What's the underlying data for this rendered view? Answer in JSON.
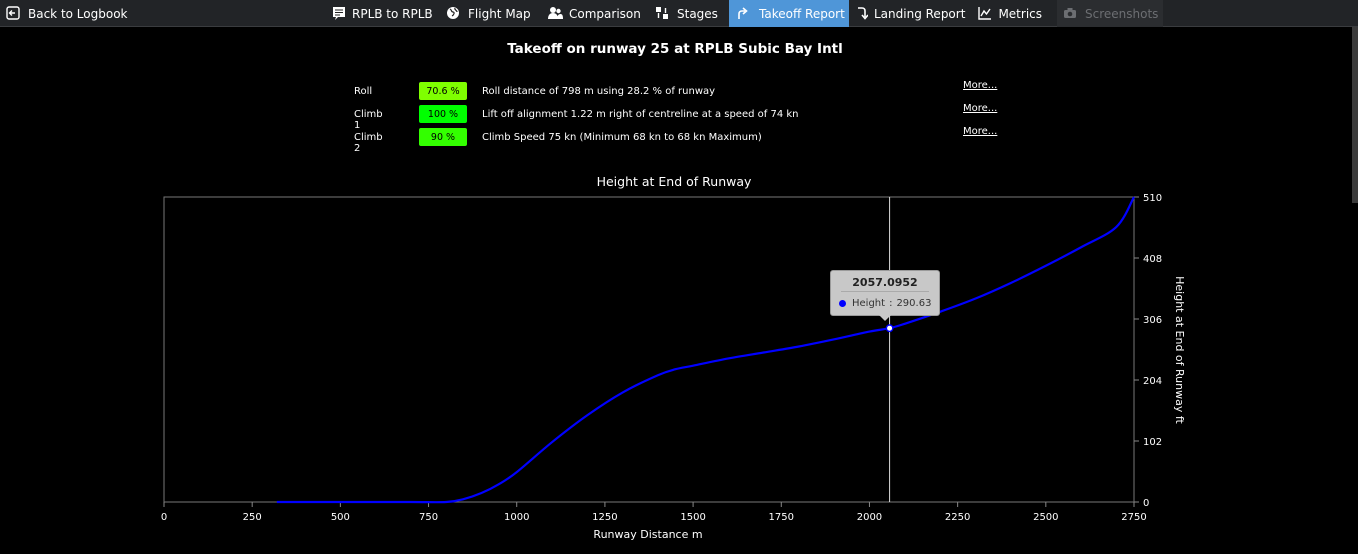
{
  "nav": {
    "back": {
      "label": "Back to Logbook",
      "icon": "back-arrow-icon"
    },
    "items": [
      {
        "label": "RPLB to RPLB",
        "icon": "document-icon",
        "state": "normal"
      },
      {
        "label": "Flight Map",
        "icon": "globe-icon",
        "state": "normal"
      },
      {
        "label": "Comparison",
        "icon": "users-icon",
        "state": "normal"
      },
      {
        "label": "Stages",
        "icon": "stages-icon",
        "state": "normal"
      },
      {
        "label": "Takeoff Report",
        "icon": "takeoff-arrow-icon",
        "state": "active"
      },
      {
        "label": "Landing Report",
        "icon": "landing-arrow-icon",
        "state": "normal"
      },
      {
        "label": "Metrics",
        "icon": "line-chart-icon",
        "state": "normal"
      },
      {
        "label": "Screenshots",
        "icon": "camera-icon",
        "state": "disabled"
      }
    ]
  },
  "report": {
    "title": "Takeoff on runway 25 at RPLB Subic Bay Intl",
    "metrics": [
      {
        "label": "Roll",
        "score": "70.6 %",
        "color": "#7fff00",
        "description": "Roll distance of 798 m using 28.2 % of runway",
        "more": "More..."
      },
      {
        "label": "Climb 1",
        "score": "100 %",
        "color": "#00ff00",
        "description": "Lift off alignment 1.22 m right of centreline at a speed of 74 kn",
        "more": "More..."
      },
      {
        "label": "Climb 2",
        "score": "90 %",
        "color": "#33ff00",
        "description": "Climb Speed 75 kn (Minimum 68 kn to 68 kn Maximum)",
        "more": "More..."
      }
    ]
  },
  "chart_data": {
    "type": "line",
    "title": "Height at End of Runway",
    "xlabel": "Runway Distance m",
    "ylabel": "Height at End of Runway ft",
    "xlim": [
      0,
      2750
    ],
    "ylim": [
      0,
      510
    ],
    "x_ticks": [
      "0",
      "250",
      "500",
      "750",
      "1000",
      "1250",
      "1500",
      "1750",
      "2000",
      "2250",
      "2500",
      "2750"
    ],
    "y_ticks": [
      "0",
      "102",
      "204",
      "306",
      "408",
      "510"
    ],
    "y_axis_side": "right",
    "grid": false,
    "series": [
      {
        "name": "Height",
        "color": "#0000ff",
        "x": [
          320,
          500,
          700,
          800,
          850,
          900,
          950,
          1000,
          1100,
          1200,
          1300,
          1400,
          1450,
          1500,
          1600,
          1700,
          1800,
          1900,
          2000,
          2057,
          2100,
          2200,
          2300,
          2400,
          2500,
          2600,
          2700,
          2750
        ],
        "y": [
          0,
          0,
          0,
          0,
          5,
          15,
          30,
          50,
          100,
          145,
          183,
          212,
          222,
          228,
          240,
          250,
          260,
          272,
          285,
          290.63,
          298,
          318,
          340,
          366,
          395,
          426,
          460,
          510
        ]
      }
    ],
    "tooltip": {
      "x_label": "2057.0952",
      "series": "Height",
      "value": "290.63"
    },
    "crosshair_x": 2057.0952
  }
}
